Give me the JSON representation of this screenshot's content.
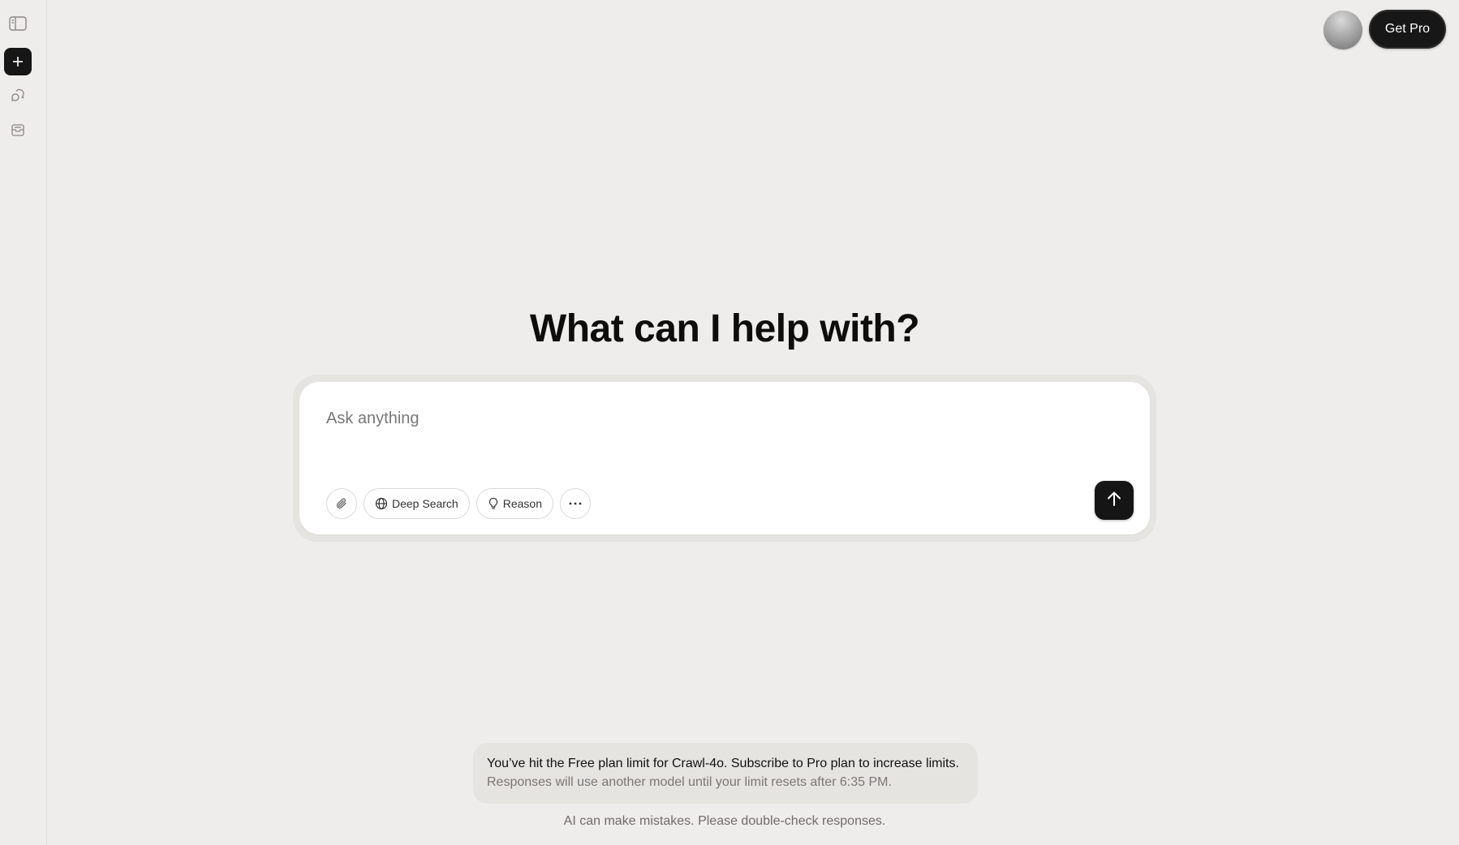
{
  "sidebar": {
    "toggle_icon": "sidebar-toggle-icon",
    "new_chat_icon": "plus-icon",
    "chats_icon": "chat-bubbles-icon",
    "library_icon": "archive-box-icon"
  },
  "header": {
    "get_pro_label": "Get Pro"
  },
  "main": {
    "headline": "What can I help with?",
    "composer": {
      "placeholder": "Ask anything",
      "tools": {
        "attach_icon": "paperclip-icon",
        "deep_search_label": "Deep Search",
        "reason_label": "Reason",
        "more_icon": "ellipsis-icon"
      },
      "send_icon": "arrow-up-icon"
    }
  },
  "notice": {
    "title": "You’ve hit the Free plan limit for Crawl-4o. Subscribe to Pro plan to increase limits.",
    "subtitle": "Responses will use another model until your limit resets after 6:35 PM."
  },
  "footer": {
    "disclaimer": "AI can make mistakes. Please double-check responses."
  },
  "colors": {
    "background": "#efedeb",
    "accent_dark": "#151515",
    "composer_bg": "#ffffff"
  }
}
